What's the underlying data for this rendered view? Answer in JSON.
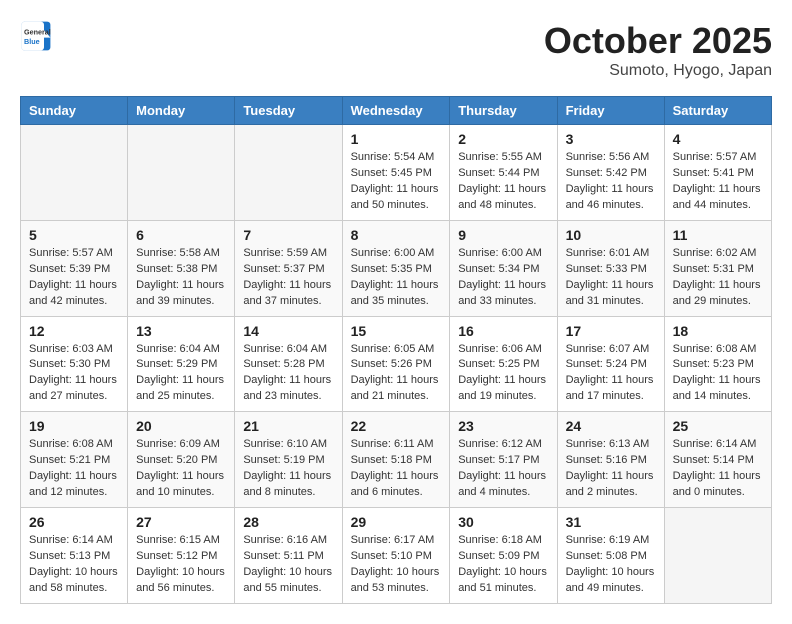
{
  "header": {
    "logo_general": "General",
    "logo_blue": "Blue",
    "month": "October 2025",
    "location": "Sumoto, Hyogo, Japan"
  },
  "weekdays": [
    "Sunday",
    "Monday",
    "Tuesday",
    "Wednesday",
    "Thursday",
    "Friday",
    "Saturday"
  ],
  "weeks": [
    [
      {
        "day": "",
        "info": ""
      },
      {
        "day": "",
        "info": ""
      },
      {
        "day": "",
        "info": ""
      },
      {
        "day": "1",
        "info": "Sunrise: 5:54 AM\nSunset: 5:45 PM\nDaylight: 11 hours and 50 minutes."
      },
      {
        "day": "2",
        "info": "Sunrise: 5:55 AM\nSunset: 5:44 PM\nDaylight: 11 hours and 48 minutes."
      },
      {
        "day": "3",
        "info": "Sunrise: 5:56 AM\nSunset: 5:42 PM\nDaylight: 11 hours and 46 minutes."
      },
      {
        "day": "4",
        "info": "Sunrise: 5:57 AM\nSunset: 5:41 PM\nDaylight: 11 hours and 44 minutes."
      }
    ],
    [
      {
        "day": "5",
        "info": "Sunrise: 5:57 AM\nSunset: 5:39 PM\nDaylight: 11 hours and 42 minutes."
      },
      {
        "day": "6",
        "info": "Sunrise: 5:58 AM\nSunset: 5:38 PM\nDaylight: 11 hours and 39 minutes."
      },
      {
        "day": "7",
        "info": "Sunrise: 5:59 AM\nSunset: 5:37 PM\nDaylight: 11 hours and 37 minutes."
      },
      {
        "day": "8",
        "info": "Sunrise: 6:00 AM\nSunset: 5:35 PM\nDaylight: 11 hours and 35 minutes."
      },
      {
        "day": "9",
        "info": "Sunrise: 6:00 AM\nSunset: 5:34 PM\nDaylight: 11 hours and 33 minutes."
      },
      {
        "day": "10",
        "info": "Sunrise: 6:01 AM\nSunset: 5:33 PM\nDaylight: 11 hours and 31 minutes."
      },
      {
        "day": "11",
        "info": "Sunrise: 6:02 AM\nSunset: 5:31 PM\nDaylight: 11 hours and 29 minutes."
      }
    ],
    [
      {
        "day": "12",
        "info": "Sunrise: 6:03 AM\nSunset: 5:30 PM\nDaylight: 11 hours and 27 minutes."
      },
      {
        "day": "13",
        "info": "Sunrise: 6:04 AM\nSunset: 5:29 PM\nDaylight: 11 hours and 25 minutes."
      },
      {
        "day": "14",
        "info": "Sunrise: 6:04 AM\nSunset: 5:28 PM\nDaylight: 11 hours and 23 minutes."
      },
      {
        "day": "15",
        "info": "Sunrise: 6:05 AM\nSunset: 5:26 PM\nDaylight: 11 hours and 21 minutes."
      },
      {
        "day": "16",
        "info": "Sunrise: 6:06 AM\nSunset: 5:25 PM\nDaylight: 11 hours and 19 minutes."
      },
      {
        "day": "17",
        "info": "Sunrise: 6:07 AM\nSunset: 5:24 PM\nDaylight: 11 hours and 17 minutes."
      },
      {
        "day": "18",
        "info": "Sunrise: 6:08 AM\nSunset: 5:23 PM\nDaylight: 11 hours and 14 minutes."
      }
    ],
    [
      {
        "day": "19",
        "info": "Sunrise: 6:08 AM\nSunset: 5:21 PM\nDaylight: 11 hours and 12 minutes."
      },
      {
        "day": "20",
        "info": "Sunrise: 6:09 AM\nSunset: 5:20 PM\nDaylight: 11 hours and 10 minutes."
      },
      {
        "day": "21",
        "info": "Sunrise: 6:10 AM\nSunset: 5:19 PM\nDaylight: 11 hours and 8 minutes."
      },
      {
        "day": "22",
        "info": "Sunrise: 6:11 AM\nSunset: 5:18 PM\nDaylight: 11 hours and 6 minutes."
      },
      {
        "day": "23",
        "info": "Sunrise: 6:12 AM\nSunset: 5:17 PM\nDaylight: 11 hours and 4 minutes."
      },
      {
        "day": "24",
        "info": "Sunrise: 6:13 AM\nSunset: 5:16 PM\nDaylight: 11 hours and 2 minutes."
      },
      {
        "day": "25",
        "info": "Sunrise: 6:14 AM\nSunset: 5:14 PM\nDaylight: 11 hours and 0 minutes."
      }
    ],
    [
      {
        "day": "26",
        "info": "Sunrise: 6:14 AM\nSunset: 5:13 PM\nDaylight: 10 hours and 58 minutes."
      },
      {
        "day": "27",
        "info": "Sunrise: 6:15 AM\nSunset: 5:12 PM\nDaylight: 10 hours and 56 minutes."
      },
      {
        "day": "28",
        "info": "Sunrise: 6:16 AM\nSunset: 5:11 PM\nDaylight: 10 hours and 55 minutes."
      },
      {
        "day": "29",
        "info": "Sunrise: 6:17 AM\nSunset: 5:10 PM\nDaylight: 10 hours and 53 minutes."
      },
      {
        "day": "30",
        "info": "Sunrise: 6:18 AM\nSunset: 5:09 PM\nDaylight: 10 hours and 51 minutes."
      },
      {
        "day": "31",
        "info": "Sunrise: 6:19 AM\nSunset: 5:08 PM\nDaylight: 10 hours and 49 minutes."
      },
      {
        "day": "",
        "info": ""
      }
    ]
  ]
}
